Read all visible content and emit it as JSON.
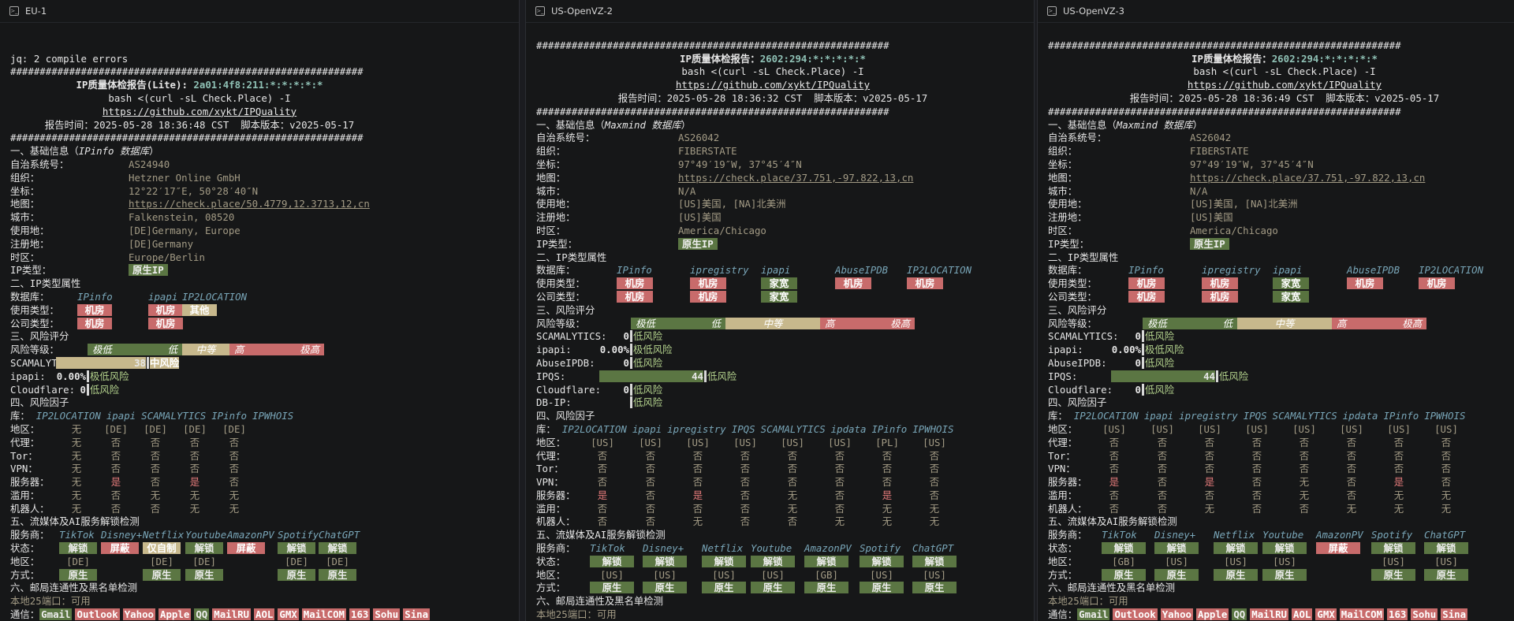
{
  "panes": [
    {
      "title": "EU-1",
      "error": "jq: 2 compile errors",
      "hash_line": "############################################################",
      "report_title": "IP质量体检报告(Lite): ",
      "ip": "2a01:4f8:211:*:*:*:*:*",
      "command": "bash <(curl -sL Check.Place) -I",
      "repo_url": "https://github.com/xykt/IPQuality",
      "report_time": "报告时间：2025-05-28 18:36:48 CST  脚本版本：v2025-05-17",
      "s1_title": "一、基础信息（",
      "s1_db": "IPinfo 数据库",
      "s1_close": "）",
      "basic_labels": [
        "自治系统号：",
        "组织：",
        "坐标：",
        "地图：",
        "城市：",
        "使用地：",
        "注册地：",
        "时区：",
        "IP类型："
      ],
      "basic_values": [
        "AS24940",
        "Hetzner Online GmbH",
        "12°22′17″E, 50°28′40″N",
        "https://check.place/50.4779,12.3713,12,cn",
        "Falkenstein, 08520",
        "[DE]Germany, Europe",
        "[DE]Germany",
        "Europe/Berlin",
        "原生IP"
      ],
      "s2_title": "二、IP类型属性",
      "db_label": "数据库：",
      "type_dbs": [
        "IPinfo",
        "ipapi",
        "IP2LOCATION"
      ],
      "usage_label": "使用类型：",
      "usage_values": [
        "机房",
        "机房",
        "其他"
      ],
      "company_label": "公司类型：",
      "company_values": [
        "机房",
        "机房"
      ],
      "s3_title": "三、风险评分",
      "risk_label": "风险等级：",
      "scale": [
        "极低",
        "低",
        "中等",
        "高",
        "极高"
      ],
      "scores": [
        {
          "name": "SCAMALYTICS:",
          "value": "38",
          "text": "中风险",
          "fraction": 0.38
        },
        {
          "name": "ipapi:",
          "value": "0.00%",
          "text": "极低风险",
          "fraction": 0
        },
        {
          "name": "Cloudflare:",
          "value": "0",
          "text": "低风险",
          "fraction": 0
        }
      ],
      "s4_title": "四、风险因子",
      "factor_lib_label": "库：",
      "factor_dbs": [
        "IP2LOCATION",
        "ipapi",
        "SCAMALYTICS",
        "IPinfo",
        "IPWHOIS"
      ],
      "factor_rows": [
        {
          "label": "地区：",
          "cells": [
            "无",
            "[DE]",
            "[DE]",
            "[DE]",
            "[DE]"
          ]
        },
        {
          "label": "代理：",
          "cells": [
            "无",
            "否",
            "否",
            "否",
            "否"
          ]
        },
        {
          "label": "Tor：",
          "cells": [
            "无",
            "否",
            "否",
            "否",
            "否"
          ]
        },
        {
          "label": "VPN：",
          "cells": [
            "无",
            "否",
            "否",
            "否",
            "否"
          ]
        },
        {
          "label": "服务器：",
          "cells": [
            "无",
            "是",
            "否",
            "是",
            "否"
          ]
        },
        {
          "label": "滥用：",
          "cells": [
            "无",
            "否",
            "无",
            "无",
            "无"
          ]
        },
        {
          "label": "机器人：",
          "cells": [
            "无",
            "否",
            "否",
            "无",
            "无"
          ]
        }
      ],
      "s5_title": "五、流媒体及AI服务解锁检测",
      "svc_label": "服务商：",
      "services": [
        "TikTok",
        "Disney+",
        "Netflix",
        "Youtube",
        "AmazonPV",
        "Spotify",
        "ChatGPT"
      ],
      "status_label": "状态：",
      "status_values": [
        "解锁",
        "屏蔽",
        "仅自制",
        "解锁",
        "屏蔽",
        "解锁",
        "解锁"
      ],
      "region_label": "地区：",
      "region_values": [
        "[DE]",
        "",
        "[DE]",
        "[DE]",
        "",
        "[DE]",
        "[DE]"
      ],
      "method_label": "方式：",
      "method_values": [
        "原生",
        "",
        "原生",
        "原生",
        "",
        "原生",
        "原生"
      ],
      "s6_title": "六、邮局连通性及黑名单检测",
      "port25": "本地25端口：可用",
      "mail_label": "通信：",
      "mail": [
        "Gmail",
        "Outlook",
        "Yahoo",
        "Apple",
        "QQ",
        "MailRU",
        "AOL",
        "GMX",
        "MailCOM",
        "163",
        "Sohu",
        "Sina"
      ]
    },
    {
      "title": "US-OpenVZ-2",
      "hash_line": "############################################################",
      "report_title": "IP质量体检报告：",
      "ip": "2602:294:*:*:*:*:*",
      "command": "bash <(curl -sL Check.Place) -I",
      "repo_url": "https://github.com/xykt/IPQuality",
      "report_time": "报告时间：2025-05-28 18:36:32 CST  脚本版本：v2025-05-17",
      "s1_title": "一、基础信息（",
      "s1_db": "Maxmind 数据库",
      "s1_close": "）",
      "basic_labels": [
        "自治系统号：",
        "组织：",
        "坐标：",
        "地图：",
        "城市：",
        "使用地：",
        "注册地：",
        "时区：",
        "IP类型："
      ],
      "basic_values": [
        "AS26042",
        "FIBERSTATE",
        "97°49′19″W, 37°45′4″N",
        "https://check.place/37.751,-97.822,13,cn",
        "N/A",
        "[US]美国, [NA]北美洲",
        "[US]美国",
        "America/Chicago",
        "原生IP"
      ],
      "s2_title": "二、IP类型属性",
      "db_label": "数据库：",
      "type_dbs": [
        "IPinfo",
        "ipregistry",
        "ipapi",
        "AbuseIPDB",
        "IP2LOCATION"
      ],
      "usage_label": "使用类型：",
      "usage_values": [
        "机房",
        "机房",
        "家宽",
        "机房",
        "机房"
      ],
      "company_label": "公司类型：",
      "company_values": [
        "机房",
        "机房",
        "家宽"
      ],
      "s3_title": "三、风险评分",
      "risk_label": "风险等级：",
      "scale": [
        "极低",
        "低",
        "中等",
        "高",
        "极高"
      ],
      "scores": [
        {
          "name": "SCAMALYTICS:",
          "value": "0",
          "text": "低风险",
          "fraction": 0
        },
        {
          "name": "ipapi:",
          "value": "0.00%",
          "text": "极低风险",
          "fraction": 0
        },
        {
          "name": "AbuseIPDB:",
          "value": "0",
          "text": "低风险",
          "fraction": 0
        },
        {
          "name": "IPQS:",
          "value": "44",
          "text": "低风险",
          "fraction": 0.44
        },
        {
          "name": "Cloudflare:",
          "value": "0",
          "text": "低风险",
          "fraction": 0
        },
        {
          "name": "DB-IP:",
          "value": "",
          "text": "低风险",
          "fraction": 0
        }
      ],
      "s4_title": "四、风险因子",
      "factor_lib_label": "库：",
      "factor_dbs": [
        "IP2LOCATION",
        "ipapi",
        "ipregistry",
        "IPQS",
        "SCAMALYTICS",
        "ipdata",
        "IPinfo",
        "IPWHOIS"
      ],
      "factor_rows": [
        {
          "label": "地区：",
          "cells": [
            "[US]",
            "[US]",
            "[US]",
            "[US]",
            "[US]",
            "[US]",
            "[PL]",
            "[US]"
          ]
        },
        {
          "label": "代理：",
          "cells": [
            "否",
            "否",
            "否",
            "否",
            "否",
            "否",
            "否",
            "否"
          ]
        },
        {
          "label": "Tor：",
          "cells": [
            "否",
            "否",
            "否",
            "否",
            "否",
            "否",
            "否",
            "否"
          ]
        },
        {
          "label": "VPN：",
          "cells": [
            "否",
            "否",
            "否",
            "否",
            "否",
            "否",
            "否",
            "否"
          ]
        },
        {
          "label": "服务器：",
          "cells": [
            "是",
            "否",
            "是",
            "否",
            "无",
            "否",
            "是",
            "否"
          ]
        },
        {
          "label": "滥用：",
          "cells": [
            "否",
            "否",
            "否",
            "否",
            "无",
            "否",
            "无",
            "无"
          ]
        },
        {
          "label": "机器人：",
          "cells": [
            "否",
            "否",
            "无",
            "否",
            "否",
            "无",
            "无",
            "无"
          ]
        }
      ],
      "s5_title": "五、流媒体及AI服务解锁检测",
      "svc_label": "服务商：",
      "services": [
        "TikTok",
        "Disney+",
        "Netflix",
        "Youtube",
        "AmazonPV",
        "Spotify",
        "ChatGPT"
      ],
      "status_label": "状态：",
      "status_values": [
        "解锁",
        "解锁",
        "解锁",
        "解锁",
        "解锁",
        "解锁",
        "解锁"
      ],
      "region_label": "地区：",
      "region_values": [
        "[US]",
        "[US]",
        "[US]",
        "[US]",
        "[GB]",
        "[US]",
        "[US]"
      ],
      "method_label": "方式：",
      "method_values": [
        "原生",
        "原生",
        "原生",
        "原生",
        "原生",
        "原生",
        "原生"
      ],
      "s6_title": "六、邮局连通性及黑名单检测",
      "port25": "本地25端口：可用",
      "mail_label": "通信：",
      "mail": [
        "Gmail",
        "Outlook",
        "Yahoo",
        "Apple",
        "QQ",
        "MailRU",
        "AOL",
        "GMX",
        "MailCOM",
        "163",
        "Sohu",
        "Sina"
      ]
    },
    {
      "title": "US-OpenVZ-3",
      "hash_line": "############################################################",
      "report_title": "IP质量体检报告：",
      "ip": "2602:294:*:*:*:*:*",
      "command": "bash <(curl -sL Check.Place) -I",
      "repo_url": "https://github.com/xykt/IPQuality",
      "report_time": "报告时间：2025-05-28 18:36:49 CST  脚本版本：v2025-05-17",
      "s1_title": "一、基础信息（",
      "s1_db": "Maxmind 数据库",
      "s1_close": "）",
      "basic_labels": [
        "自治系统号：",
        "组织：",
        "坐标：",
        "地图：",
        "城市：",
        "使用地：",
        "注册地：",
        "时区：",
        "IP类型："
      ],
      "basic_values": [
        "AS26042",
        "FIBERSTATE",
        "97°49′19″W, 37°45′4″N",
        "https://check.place/37.751,-97.822,13,cn",
        "N/A",
        "[US]美国, [NA]北美洲",
        "[US]美国",
        "America/Chicago",
        "原生IP"
      ],
      "s2_title": "二、IP类型属性",
      "db_label": "数据库：",
      "type_dbs": [
        "IPinfo",
        "ipregistry",
        "ipapi",
        "AbuseIPDB",
        "IP2LOCATION"
      ],
      "usage_label": "使用类型：",
      "usage_values": [
        "机房",
        "机房",
        "家宽",
        "机房",
        "机房"
      ],
      "company_label": "公司类型：",
      "company_values": [
        "机房",
        "机房",
        "家宽"
      ],
      "s3_title": "三、风险评分",
      "risk_label": "风险等级：",
      "scale": [
        "极低",
        "低",
        "中等",
        "高",
        "极高"
      ],
      "scores": [
        {
          "name": "SCAMALYTICS:",
          "value": "0",
          "text": "低风险",
          "fraction": 0
        },
        {
          "name": "ipapi:",
          "value": "0.00%",
          "text": "极低风险",
          "fraction": 0
        },
        {
          "name": "AbuseIPDB:",
          "value": "0",
          "text": "低风险",
          "fraction": 0
        },
        {
          "name": "IPQS:",
          "value": "44",
          "text": "低风险",
          "fraction": 0.44
        },
        {
          "name": "Cloudflare:",
          "value": "0",
          "text": "低风险",
          "fraction": 0
        }
      ],
      "s4_title": "四、风险因子",
      "factor_lib_label": "库：",
      "factor_dbs": [
        "IP2LOCATION",
        "ipapi",
        "ipregistry",
        "IPQS",
        "SCAMALYTICS",
        "ipdata",
        "IPinfo",
        "IPWHOIS"
      ],
      "factor_rows": [
        {
          "label": "地区：",
          "cells": [
            "[US]",
            "[US]",
            "[US]",
            "[US]",
            "[US]",
            "[US]",
            "[US]",
            "[US]"
          ]
        },
        {
          "label": "代理：",
          "cells": [
            "否",
            "否",
            "否",
            "否",
            "否",
            "否",
            "否",
            "否"
          ]
        },
        {
          "label": "Tor：",
          "cells": [
            "否",
            "否",
            "否",
            "否",
            "否",
            "否",
            "否",
            "否"
          ]
        },
        {
          "label": "VPN：",
          "cells": [
            "否",
            "否",
            "否",
            "否",
            "否",
            "否",
            "否",
            "否"
          ]
        },
        {
          "label": "服务器：",
          "cells": [
            "是",
            "否",
            "是",
            "否",
            "无",
            "否",
            "是",
            "否"
          ]
        },
        {
          "label": "滥用：",
          "cells": [
            "否",
            "否",
            "否",
            "否",
            "无",
            "否",
            "无",
            "无"
          ]
        },
        {
          "label": "机器人：",
          "cells": [
            "否",
            "否",
            "无",
            "否",
            "否",
            "无",
            "无",
            "无"
          ]
        }
      ],
      "s5_title": "五、流媒体及AI服务解锁检测",
      "svc_label": "服务商：",
      "services": [
        "TikTok",
        "Disney+",
        "Netflix",
        "Youtube",
        "AmazonPV",
        "Spotify",
        "ChatGPT"
      ],
      "status_label": "状态：",
      "status_values": [
        "解锁",
        "解锁",
        "解锁",
        "解锁",
        "屏蔽",
        "解锁",
        "解锁"
      ],
      "region_label": "地区：",
      "region_values": [
        "[GB]",
        "[US]",
        "[US]",
        "[US]",
        "",
        "[US]",
        "[US]"
      ],
      "method_label": "方式：",
      "method_values": [
        "原生",
        "原生",
        "原生",
        "原生",
        "",
        "原生",
        "原生"
      ],
      "s6_title": "六、邮局连通性及黑名单检测",
      "port25": "本地25端口：可用",
      "mail_label": "通信：",
      "mail": [
        "Gmail",
        "Outlook",
        "Yahoo",
        "Apple",
        "QQ",
        "MailRU",
        "AOL",
        "GMX",
        "MailCOM",
        "163",
        "Sohu",
        "Sina"
      ],
      "eq_line": "============================================================"
    }
  ]
}
